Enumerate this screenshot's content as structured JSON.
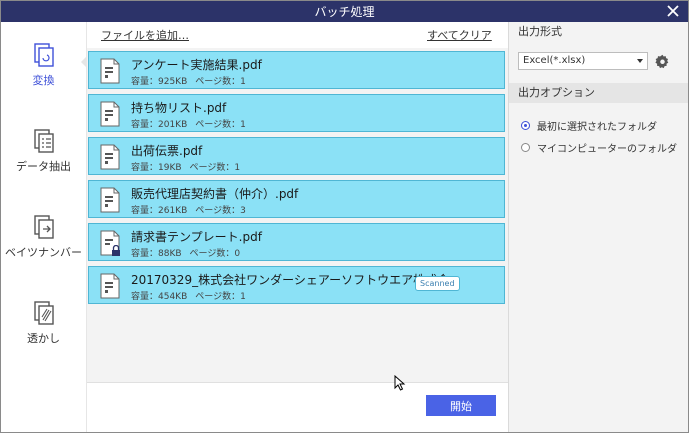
{
  "window": {
    "title": "バッチ処理"
  },
  "sidebar": {
    "items": [
      {
        "label": "変換",
        "icon": "convert-icon",
        "active": true
      },
      {
        "label": "データ抽出",
        "icon": "data-extract-icon",
        "active": false
      },
      {
        "label": "ベイツナンバー",
        "icon": "bates-number-icon",
        "active": false
      },
      {
        "label": "透かし",
        "icon": "watermark-icon",
        "active": false
      }
    ]
  },
  "toolbar": {
    "add_files": "ファイルを追加…",
    "clear_all": "すべてクリア"
  },
  "files": [
    {
      "name": "アンケート実施結果.pdf",
      "size": "容量：925KB",
      "pages": "ページ数：1",
      "locked": false,
      "scanned": false
    },
    {
      "name": "持ち物リスト.pdf",
      "size": "容量：201KB",
      "pages": "ページ数：1",
      "locked": false,
      "scanned": false
    },
    {
      "name": "出荷伝票.pdf",
      "size": "容量：19KB",
      "pages": "ページ数：1",
      "locked": false,
      "scanned": false
    },
    {
      "name": "販売代理店契約書（仲介）.pdf",
      "size": "容量：261KB",
      "pages": "ページ数：3",
      "locked": false,
      "scanned": false
    },
    {
      "name": "請求書テンプレート.pdf",
      "size": "容量：88KB",
      "pages": "ページ数：0",
      "locked": true,
      "scanned": false
    },
    {
      "name": "20170329_株式会社ワンダーシェアーソフトウエア株式会...",
      "size": "容量：454KB",
      "pages": "ページ数：1",
      "locked": false,
      "scanned": true,
      "badge": "Scanned"
    }
  ],
  "actions": {
    "start": "開始"
  },
  "output": {
    "format_title": "出力形式",
    "format_value": "Excel(*.xlsx)",
    "options_title": "出力オプション",
    "options": [
      {
        "label": "最初に選択されたフォルダ",
        "selected": true
      },
      {
        "label": "マイコンピューターのフォルダ",
        "selected": false
      }
    ]
  },
  "colors": {
    "title_bar": "#2c3369",
    "accent": "#3f51d8",
    "file_bg": "#8be1f6",
    "start_button": "#4a63e6"
  }
}
